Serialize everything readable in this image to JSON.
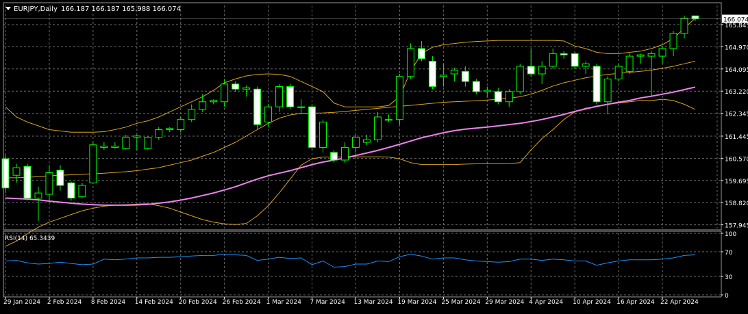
{
  "header": {
    "symbol_label": "EURJPY,Daily",
    "ohlc_text": "166.187 166.187 165.988 166.074"
  },
  "rsi_panel": {
    "label": "RSI(14) 65.3439"
  },
  "colors": {
    "background": "#000000",
    "grid": "#6e6e6e",
    "bull_body": "#00ff00",
    "bear_body": "#ffffff",
    "candle_outline": "#00ff00",
    "ma": "#ee82ee",
    "bollinger": "#daa520",
    "rsi_line": "#1e90ff",
    "text": "#ffffff",
    "price_label_bg": "#ffffff",
    "price_label_text": "#000000"
  },
  "chart_data": [
    {
      "type": "candlestick",
      "title": "EURJPY,Daily",
      "ylim": [
        157.8,
        166.6
      ],
      "y_ticks": [
        "165.845",
        "164.970",
        "164.095",
        "163.220",
        "162.345",
        "161.445",
        "160.570",
        "159.695",
        "158.820",
        "157.945"
      ],
      "current_price_label": "166.074",
      "x_tick_labels": [
        "29 Jan 2024",
        "2 Feb 2024",
        "8 Feb 2024",
        "14 Feb 2024",
        "20 Feb 2024",
        "26 Feb 2024",
        "1 Mar 2024",
        "7 Mar 2024",
        "13 Mar 2024",
        "19 Mar 2024",
        "25 Mar 2024",
        "29 Mar 2024",
        "4 Apr 2024",
        "10 Apr 2024",
        "16 Apr 2024",
        "22 Apr 2024"
      ],
      "candles": [
        {
          "o": 160.55,
          "h": 160.7,
          "c": 159.4,
          "l": 159.2
        },
        {
          "o": 159.9,
          "h": 160.35,
          "c": 160.2,
          "l": 159.6
        },
        {
          "o": 160.25,
          "h": 160.35,
          "c": 159.0,
          "l": 158.9
        },
        {
          "o": 159.0,
          "h": 159.45,
          "c": 159.2,
          "l": 158.1
        },
        {
          "o": 159.15,
          "h": 160.3,
          "c": 160.0,
          "l": 158.9
        },
        {
          "o": 160.1,
          "h": 160.3,
          "c": 159.5,
          "l": 159.3
        },
        {
          "o": 159.6,
          "h": 159.65,
          "c": 159.0,
          "l": 158.9
        },
        {
          "o": 159.05,
          "h": 159.6,
          "c": 159.5,
          "l": 159.0
        },
        {
          "o": 159.6,
          "h": 161.2,
          "c": 161.1,
          "l": 159.6
        },
        {
          "o": 161.0,
          "h": 161.2,
          "c": 161.05,
          "l": 160.9
        },
        {
          "o": 161.0,
          "h": 161.2,
          "c": 161.05,
          "l": 160.95
        },
        {
          "o": 160.95,
          "h": 161.5,
          "c": 161.4,
          "l": 160.9
        },
        {
          "o": 161.4,
          "h": 161.5,
          "c": 161.45,
          "l": 160.9
        },
        {
          "o": 160.95,
          "h": 161.45,
          "c": 161.4,
          "l": 160.9
        },
        {
          "o": 161.4,
          "h": 161.8,
          "c": 161.7,
          "l": 161.3
        },
        {
          "o": 161.7,
          "h": 161.8,
          "c": 161.75,
          "l": 161.6
        },
        {
          "o": 161.7,
          "h": 162.2,
          "c": 162.1,
          "l": 161.6
        },
        {
          "o": 162.1,
          "h": 162.7,
          "c": 162.5,
          "l": 162.0
        },
        {
          "o": 162.5,
          "h": 163.1,
          "c": 162.8,
          "l": 162.4
        },
        {
          "o": 162.8,
          "h": 162.9,
          "c": 162.85,
          "l": 162.7
        },
        {
          "o": 162.8,
          "h": 163.7,
          "c": 163.5,
          "l": 162.6
        },
        {
          "o": 163.5,
          "h": 163.6,
          "c": 163.3,
          "l": 163.2
        },
        {
          "o": 163.3,
          "h": 163.45,
          "c": 163.35,
          "l": 163.0
        },
        {
          "o": 163.3,
          "h": 163.4,
          "c": 161.9,
          "l": 161.7
        },
        {
          "o": 162.0,
          "h": 162.7,
          "c": 162.6,
          "l": 161.8
        },
        {
          "o": 162.6,
          "h": 163.5,
          "c": 163.4,
          "l": 162.4
        },
        {
          "o": 163.4,
          "h": 163.5,
          "c": 162.6,
          "l": 162.5
        },
        {
          "o": 162.6,
          "h": 162.9,
          "c": 162.6,
          "l": 162.3
        },
        {
          "o": 162.6,
          "h": 162.7,
          "c": 161.0,
          "l": 160.9
        },
        {
          "o": 161.0,
          "h": 162.1,
          "c": 162.0,
          "l": 160.8
        },
        {
          "o": 160.8,
          "h": 160.9,
          "c": 160.5,
          "l": 160.4
        },
        {
          "o": 160.5,
          "h": 161.2,
          "c": 161.0,
          "l": 160.4
        },
        {
          "o": 161.0,
          "h": 161.5,
          "c": 161.4,
          "l": 160.8
        },
        {
          "o": 161.2,
          "h": 161.5,
          "c": 161.3,
          "l": 161.1
        },
        {
          "o": 161.3,
          "h": 162.4,
          "c": 162.2,
          "l": 161.2
        },
        {
          "o": 162.1,
          "h": 162.3,
          "c": 162.1,
          "l": 162.0
        },
        {
          "o": 162.1,
          "h": 163.9,
          "c": 163.8,
          "l": 161.9
        },
        {
          "o": 163.8,
          "h": 165.1,
          "c": 164.9,
          "l": 163.7
        },
        {
          "o": 164.9,
          "h": 165.2,
          "c": 164.5,
          "l": 164.4
        },
        {
          "o": 164.4,
          "h": 164.6,
          "c": 163.4,
          "l": 163.3
        },
        {
          "o": 163.8,
          "h": 164.3,
          "c": 163.85,
          "l": 163.4
        },
        {
          "o": 163.9,
          "h": 164.15,
          "c": 164.05,
          "l": 163.6
        },
        {
          "o": 164.0,
          "h": 164.2,
          "c": 163.6,
          "l": 163.4
        },
        {
          "o": 163.6,
          "h": 163.7,
          "c": 163.2,
          "l": 163.1
        },
        {
          "o": 163.2,
          "h": 163.4,
          "c": 163.25,
          "l": 163.0
        },
        {
          "o": 163.2,
          "h": 163.35,
          "c": 162.8,
          "l": 162.7
        },
        {
          "o": 162.8,
          "h": 163.3,
          "c": 163.2,
          "l": 162.6
        },
        {
          "o": 163.2,
          "h": 164.3,
          "c": 164.2,
          "l": 163.1
        },
        {
          "o": 164.2,
          "h": 164.9,
          "c": 163.9,
          "l": 163.8
        },
        {
          "o": 163.9,
          "h": 164.4,
          "c": 164.2,
          "l": 163.5
        },
        {
          "o": 164.2,
          "h": 164.9,
          "c": 164.7,
          "l": 164.1
        },
        {
          "o": 164.7,
          "h": 164.8,
          "c": 164.65,
          "l": 164.5
        },
        {
          "o": 164.7,
          "h": 164.75,
          "c": 164.2,
          "l": 164.1
        },
        {
          "o": 164.2,
          "h": 164.4,
          "c": 164.3,
          "l": 163.9
        },
        {
          "o": 164.2,
          "h": 164.3,
          "c": 162.8,
          "l": 162.7
        },
        {
          "o": 162.8,
          "h": 163.8,
          "c": 163.7,
          "l": 162.3
        },
        {
          "o": 163.7,
          "h": 164.3,
          "c": 164.2,
          "l": 163.6
        },
        {
          "o": 164.0,
          "h": 164.7,
          "c": 164.6,
          "l": 163.9
        },
        {
          "o": 164.6,
          "h": 164.7,
          "c": 164.65,
          "l": 164.3
        },
        {
          "o": 164.6,
          "h": 164.8,
          "c": 164.7,
          "l": 163.0
        },
        {
          "o": 164.6,
          "h": 165.0,
          "c": 164.9,
          "l": 164.3
        },
        {
          "o": 164.9,
          "h": 165.6,
          "c": 165.5,
          "l": 164.6
        },
        {
          "o": 165.5,
          "h": 166.2,
          "c": 166.1,
          "l": 165.3
        },
        {
          "o": 166.19,
          "h": 166.19,
          "c": 166.07,
          "l": 165.99
        }
      ],
      "moving_average": [
        159.0,
        158.98,
        158.96,
        158.93,
        158.88,
        158.84,
        158.8,
        158.76,
        158.74,
        158.72,
        158.72,
        158.72,
        158.73,
        158.75,
        158.8,
        158.85,
        158.92,
        159.0,
        159.1,
        159.2,
        159.32,
        159.45,
        159.6,
        159.75,
        159.88,
        159.98,
        160.08,
        160.2,
        160.32,
        160.42,
        160.5,
        160.58,
        160.68,
        160.78,
        160.88,
        161.0,
        161.12,
        161.25,
        161.38,
        161.48,
        161.58,
        161.66,
        161.72,
        161.76,
        161.8,
        161.85,
        161.9,
        161.95,
        162.02,
        162.1,
        162.2,
        162.3,
        162.42,
        162.52,
        162.62,
        162.7,
        162.78,
        162.85,
        162.95,
        163.02,
        163.1,
        163.18,
        163.28,
        163.38
      ],
      "bollinger_upper": [
        162.6,
        162.2,
        162.0,
        161.85,
        161.7,
        161.65,
        161.6,
        161.6,
        161.6,
        161.62,
        161.7,
        161.8,
        161.95,
        162.05,
        162.2,
        162.4,
        162.6,
        162.8,
        163.0,
        163.25,
        163.55,
        163.7,
        163.82,
        163.88,
        163.9,
        163.88,
        163.8,
        163.6,
        163.4,
        163.2,
        162.75,
        162.6,
        162.6,
        162.6,
        162.6,
        162.65,
        163.0,
        164.0,
        164.7,
        164.95,
        165.05,
        165.1,
        165.15,
        165.18,
        165.2,
        165.22,
        165.22,
        165.22,
        165.22,
        165.22,
        165.22,
        165.2,
        165.0,
        164.9,
        164.75,
        164.7,
        164.7,
        164.75,
        164.8,
        164.9,
        165.05,
        165.3,
        165.7,
        166.1
      ],
      "bollinger_mid": [
        159.8,
        159.8,
        159.82,
        159.85,
        159.88,
        159.9,
        159.92,
        159.94,
        159.96,
        159.98,
        160.01,
        160.04,
        160.08,
        160.14,
        160.2,
        160.3,
        160.4,
        160.5,
        160.65,
        160.8,
        161.0,
        161.2,
        161.45,
        161.7,
        161.95,
        162.15,
        162.28,
        162.34,
        162.35,
        162.36,
        162.38,
        162.42,
        162.46,
        162.5,
        162.54,
        162.58,
        162.62,
        162.66,
        162.7,
        162.74,
        162.78,
        162.8,
        162.82,
        162.84,
        162.87,
        162.9,
        162.94,
        163.0,
        163.1,
        163.25,
        163.42,
        163.55,
        163.65,
        163.75,
        163.82,
        163.88,
        163.92,
        163.96,
        164.0,
        164.05,
        164.12,
        164.2,
        164.3,
        164.4
      ],
      "bollinger_lower": [
        157.1,
        157.3,
        157.6,
        157.85,
        158.05,
        158.2,
        158.35,
        158.5,
        158.6,
        158.68,
        158.72,
        158.74,
        158.76,
        158.78,
        158.7,
        158.6,
        158.45,
        158.3,
        158.15,
        158.05,
        157.98,
        157.96,
        158.0,
        158.3,
        158.7,
        159.2,
        159.75,
        160.3,
        160.55,
        160.62,
        160.62,
        160.62,
        160.63,
        160.63,
        160.63,
        160.62,
        160.55,
        160.4,
        160.32,
        160.32,
        160.32,
        160.32,
        160.34,
        160.35,
        160.35,
        160.35,
        160.36,
        160.4,
        160.9,
        161.35,
        161.7,
        162.1,
        162.4,
        162.55,
        162.6,
        162.7,
        162.75,
        162.8,
        162.85,
        162.85,
        162.9,
        162.85,
        162.7,
        162.5
      ]
    },
    {
      "type": "line",
      "title": "RSI(14) 65.3439",
      "ylim": [
        0,
        100
      ],
      "y_ticks": [
        "100",
        "70",
        "30",
        "0"
      ],
      "values": [
        55,
        56,
        52,
        50,
        51,
        53,
        51,
        49,
        50,
        58,
        57,
        58,
        60,
        60,
        61,
        61,
        62,
        63,
        64,
        64,
        66,
        65,
        64,
        56,
        58,
        61,
        59,
        60,
        49,
        55,
        45,
        46,
        50,
        50,
        55,
        54,
        62,
        66,
        63,
        58,
        60,
        60,
        57,
        55,
        54,
        53,
        54,
        58,
        58,
        56,
        58,
        57,
        55,
        55,
        48,
        52,
        55,
        57,
        57,
        57,
        58,
        60,
        64,
        65
      ]
    }
  ]
}
